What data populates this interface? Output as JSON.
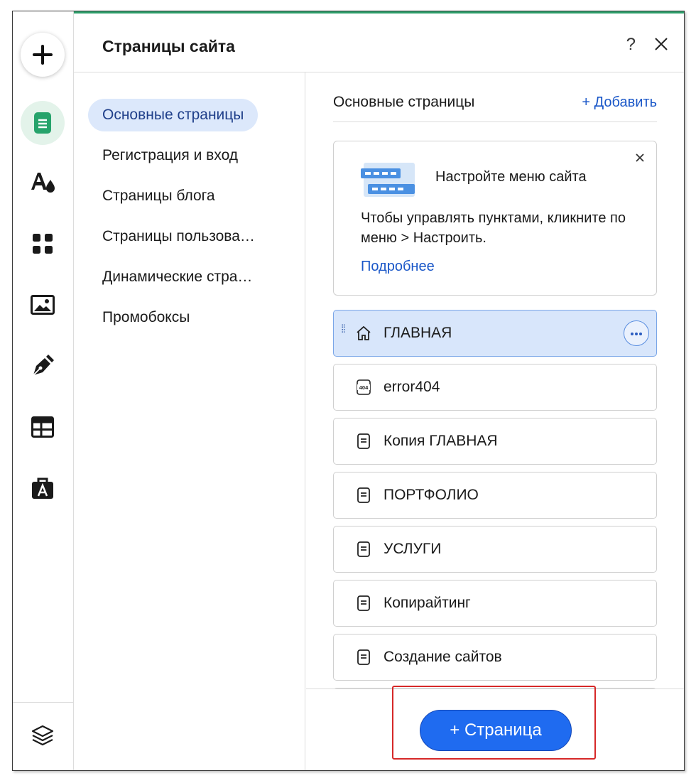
{
  "panel": {
    "title": "Страницы сайта",
    "help_label": "?"
  },
  "rail": {
    "items": [
      {
        "icon": "plus-icon"
      },
      {
        "icon": "pages-icon",
        "active": true
      },
      {
        "icon": "design-icon"
      },
      {
        "icon": "apps-icon"
      },
      {
        "icon": "media-icon"
      },
      {
        "icon": "pen-icon"
      },
      {
        "icon": "table-icon"
      },
      {
        "icon": "business-icon"
      },
      {
        "icon": "layers-icon"
      }
    ]
  },
  "categories": [
    {
      "label": "Основные страницы",
      "active": true
    },
    {
      "label": "Регистрация и вход"
    },
    {
      "label": "Страницы блога"
    },
    {
      "label": "Страницы пользова…"
    },
    {
      "label": "Динамические стра…"
    },
    {
      "label": "Промобоксы"
    }
  ],
  "pane": {
    "title": "Основные страницы",
    "add_link": "+ Добавить"
  },
  "info_card": {
    "title": "Настройте меню сайта",
    "text": "Чтобы управлять пунктами, кликните по меню > Настроить.",
    "link": "Подробнее"
  },
  "pages": [
    {
      "name": "ГЛАВНАЯ",
      "icon": "home-icon",
      "selected": true
    },
    {
      "name": "error404",
      "icon": "error-404-icon"
    },
    {
      "name": "Копия ГЛАВНАЯ",
      "icon": "page-icon"
    },
    {
      "name": "ПОРТФОЛИО",
      "icon": "page-icon"
    },
    {
      "name": "УСЛУГИ",
      "icon": "page-icon"
    },
    {
      "name": "Копирайтинг",
      "icon": "page-icon"
    },
    {
      "name": "Создание сайтов",
      "icon": "page-icon"
    }
  ],
  "footer": {
    "add_page_button": "+ Страница"
  },
  "colors": {
    "accent": "#2e9e6b",
    "link": "#1a57c8",
    "primary_button": "#1f6bf0",
    "selected_bg": "#d8e6fb",
    "highlight": "#d62828"
  }
}
